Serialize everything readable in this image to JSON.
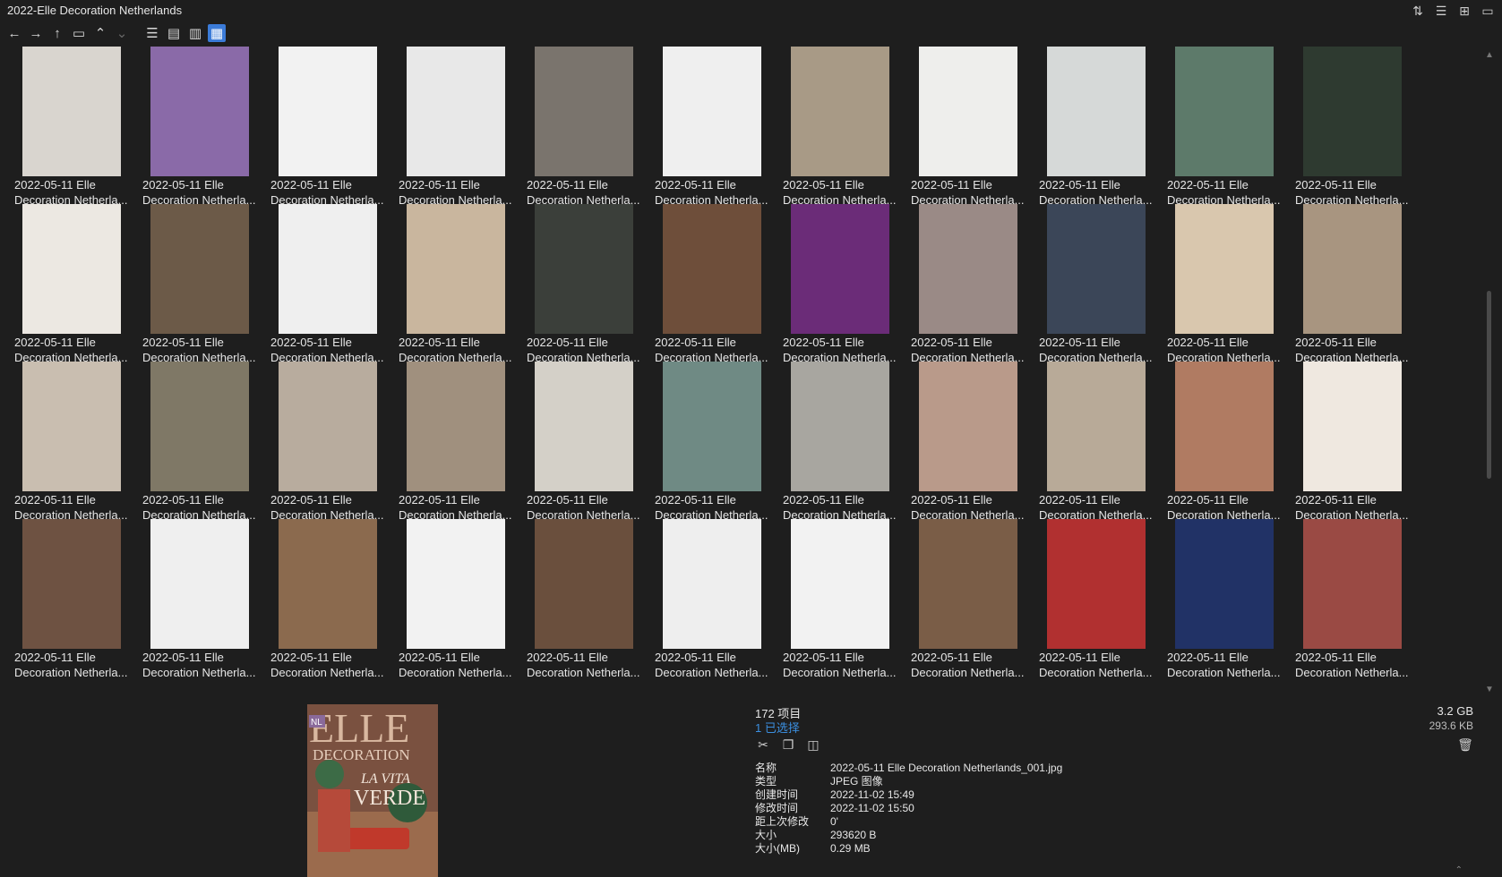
{
  "window": {
    "title": "2022-Elle Decoration Netherlands"
  },
  "icons": {
    "sort": "sort-icon",
    "details": "details-icon",
    "add-pane": "add-pane-icon",
    "clipboard": "clipboard-icon",
    "back": "back-arrow-icon",
    "forward": "forward-arrow-icon",
    "up": "up-arrow-icon",
    "folder": "folder-icon",
    "chevron-up": "chevron-up-icon",
    "chevron-down": "chevron-down-icon",
    "view-list": "list-view-icon",
    "view-tiles": "tiles-view-icon",
    "view-details": "details-view-icon",
    "view-thumbs": "thumbnail-view-icon",
    "cut": "scissors-icon",
    "copy": "copy-icon",
    "split": "split-icon",
    "delete": "trash-icon"
  },
  "grid": {
    "caption_line1": "2022-05-11 Elle",
    "caption_line2": "Decoration Netherla...",
    "thumbs": [
      "#d9d5cf",
      "#8a6aa8",
      "#f2f2f2",
      "#e8e8e8",
      "#7a746d",
      "#efefef",
      "#a89a86",
      "#eeeeec",
      "#d6d9d8",
      "#5d7a6a",
      "#2e3a30",
      "#ece8e2",
      "#6c5a48",
      "#efefef",
      "#c9b69e",
      "#3b3f3a",
      "#6e4e3a",
      "#6b2c78",
      "#9a8a86",
      "#3b4658",
      "#d9c7ae",
      "#a89580",
      "#c9beb0",
      "#7f7866",
      "#b8ac9e",
      "#a0907e",
      "#d4d0c8",
      "#6f8a84",
      "#a8a6a0",
      "#b99a8a",
      "#b8aa98",
      "#b07b62",
      "#efe8e0",
      "#6e5242",
      "#efefef",
      "#8b6a4e",
      "#f2f2f2",
      "#6a4f3d",
      "#eeeeee",
      "#f2f2f2",
      "#7a5d47",
      "#b13030",
      "#213266",
      "#9a4a44"
    ]
  },
  "status": {
    "count": "172 项目",
    "selected": "1 已选择",
    "total_size": "3.2 GB",
    "selected_size": "293.6 KB"
  },
  "props": [
    {
      "k": "名称",
      "v": "2022-05-11 Elle Decoration Netherlands_001.jpg"
    },
    {
      "k": "类型",
      "v": "JPEG 图像"
    },
    {
      "k": "创建时间",
      "v": "2022-11-02  15:49"
    },
    {
      "k": "修改时间",
      "v": "2022-11-02  15:50"
    },
    {
      "k": "距上次修改",
      "v": "0'"
    },
    {
      "k": "大小",
      "v": "293620 B"
    },
    {
      "k": "大小(MB)",
      "v": "0.29 MB"
    }
  ],
  "preview": {
    "logo": "ELLE",
    "sub": "DECORATION",
    "headline": "LA VITA",
    "headline2": "VERDE",
    "badge": "NL"
  }
}
